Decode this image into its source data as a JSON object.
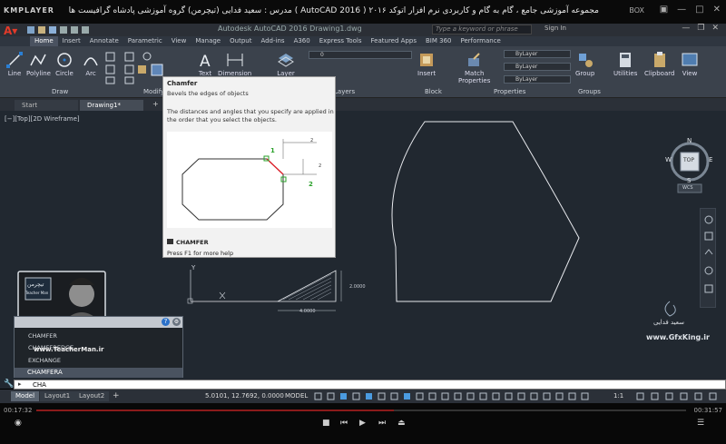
{
  "player": {
    "logo": "KMPLAYER",
    "title": "مجموعه آموزشی جامع ، گام به گام و کاربردی نرم افزار اتوکد ۲۰۱۶ ( AutoCAD 2016 ) مدرس : سعید فدایی (تیچرمن) گروه آموزشی پادشاه گرافیست ها",
    "box_label": "BOX",
    "time_elapsed": "00:17:32",
    "time_total": "00:31:57",
    "progress": 0.55
  },
  "acad": {
    "title": "Autodesk AutoCAD 2016   Drawing1.dwg",
    "search_placeholder": "Type a keyword or phrase",
    "signin": "Sign In"
  },
  "ribbon_tabs": [
    "Home",
    "Insert",
    "Annotate",
    "Parametric",
    "View",
    "Manage",
    "Output",
    "Add-ins",
    "A360",
    "Express Tools",
    "Featured Apps",
    "BIM 360",
    "Performance"
  ],
  "ribbon": {
    "line": "Line",
    "polyline": "Polyline",
    "circle": "Circle",
    "arc": "Arc",
    "text": "Text",
    "dimension": "Dimension",
    "layer": "Layer",
    "insert": "Insert",
    "match_properties_1": "Match",
    "match_properties_2": "Properties",
    "group": "Group",
    "utilities": "Utilities",
    "clipboard": "Clipboard",
    "view": "View",
    "groups": {
      "draw": "Draw",
      "modify": "Modify",
      "layers": "Layers",
      "block": "Block",
      "properties": "Properties",
      "groups": "Groups"
    },
    "bylayer_1": "ByLayer",
    "bylayer_2": "ByLayer",
    "bylayer_3": "ByLayer",
    "layer_value": "0"
  },
  "file_tabs": {
    "start": "Start",
    "drawing": "Drawing1*"
  },
  "viewport_label": "[−][Top][2D Wireframe]",
  "tooltip": {
    "title": "Chamfer",
    "subtitle": "Bevels the edges of objects",
    "description": "The distances and angles that you specify are applied in the order that you select the objects.",
    "label_1": "1",
    "label_2": "2",
    "dim_2a": "2",
    "dim_2b": "2",
    "command": "CHAMFER",
    "help": "Press F1 for more help"
  },
  "viewcube": {
    "n": "N",
    "s": "S",
    "e": "E",
    "w": "W",
    "top": "TOP",
    "wcs": "WCS"
  },
  "drawing": {
    "dim_vertical": "2.0000",
    "dim_horizontal": "4.0000",
    "y_axis": "Y"
  },
  "teacher": {
    "badge_line1": "تیچرمن",
    "badge_line2": "Teacher Man",
    "url": "www.TeacherMan.ir"
  },
  "brand": {
    "name": "سعید فدایی",
    "site": "www.GfxKing.ir"
  },
  "autocomplete": {
    "items": [
      "CHAMFER",
      "CHAMFEREDGE",
      "EXCHANGE"
    ],
    "selected": "CHAMFERA"
  },
  "command": {
    "text": "CHA"
  },
  "layout_tabs": [
    "Model",
    "Layout1",
    "Layout2"
  ],
  "status": {
    "coords": "5.0101, 12.7692, 0.0000",
    "model": "MODEL",
    "scale": "1:1"
  },
  "colors": {
    "accent": "#e23a2a",
    "canvas": "#212830",
    "ribbon": "#3b424c",
    "chamfer_highlight": "#e0202a",
    "dim_green": "#2aa12a"
  }
}
